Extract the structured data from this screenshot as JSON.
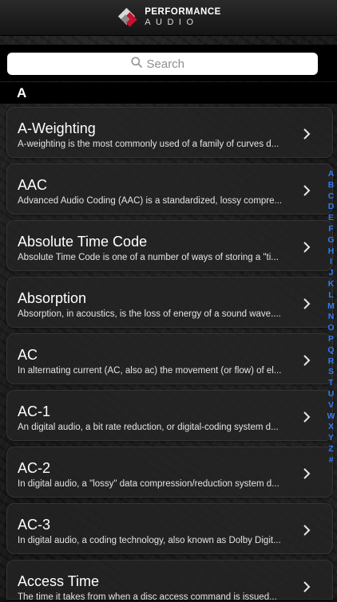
{
  "header": {
    "logo_line1": "PERFORMANCE",
    "logo_line2": "AUDIO"
  },
  "search": {
    "placeholder": "Search",
    "icon": "search-icon"
  },
  "section": {
    "letter": "A"
  },
  "terms": [
    {
      "title": "A-Weighting",
      "description": "A-weighting is the most commonly used of a family of curves d..."
    },
    {
      "title": "AAC",
      "description": "Advanced Audio Coding (AAC) is a standardized, lossy compre..."
    },
    {
      "title": "Absolute Time Code",
      "description": "Absolute Time Code is one of a number of ways of storing a \"ti..."
    },
    {
      "title": "Absorption",
      "description": "Absorption, in acoustics, is the loss of energy of a sound wave...."
    },
    {
      "title": "AC",
      "description": "In alternating current (AC, also ac) the movement (or flow) of el..."
    },
    {
      "title": "AC-1",
      "description": "An digital audio, a bit rate reduction, or digital-coding system d..."
    },
    {
      "title": "AC-2",
      "description": "In digital audio, a \"lossy\" data compression/reduction system d..."
    },
    {
      "title": "AC-3",
      "description": "In digital audio, a coding technology, also known as Dolby Digit..."
    },
    {
      "title": "Access Time",
      "description": "The time it takes from when a disc access command is issued..."
    }
  ],
  "index_letters": [
    "A",
    "B",
    "C",
    "D",
    "E",
    "F",
    "G",
    "H",
    "I",
    "J",
    "K",
    "L",
    "M",
    "N",
    "O",
    "P",
    "Q",
    "R",
    "S",
    "T",
    "U",
    "V",
    "W",
    "X",
    "Y",
    "Z",
    "#"
  ],
  "colors": {
    "accent": "#2f7cf6",
    "brand_red": "#c8102e"
  }
}
